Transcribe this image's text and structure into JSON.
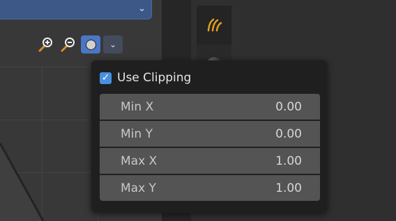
{
  "icons": {
    "dropdown_chevron": "chevron-down-icon",
    "zoom_in": "zoom-in-icon",
    "zoom_out": "zoom-out-icon",
    "zoom_toggle": "zoom-region-icon",
    "toolbar_dropdown": "chevron-down-icon",
    "side_tab": "curve-tab-icon",
    "material_ball": "material-ball-icon",
    "checkbox_check": "checkmark-icon"
  },
  "colors": {
    "accent_blue": "#4a77c5",
    "checkbox_blue": "#4a90e2",
    "curve_orange": "#e0a020"
  },
  "popover": {
    "use_clipping": {
      "label": "Use Clipping",
      "checked": true
    },
    "fields": [
      {
        "label": "Min X",
        "value": "0.00"
      },
      {
        "label": "Min Y",
        "value": "0.00"
      },
      {
        "label": "Max X",
        "value": "1.00"
      },
      {
        "label": "Max Y",
        "value": "1.00"
      }
    ]
  }
}
